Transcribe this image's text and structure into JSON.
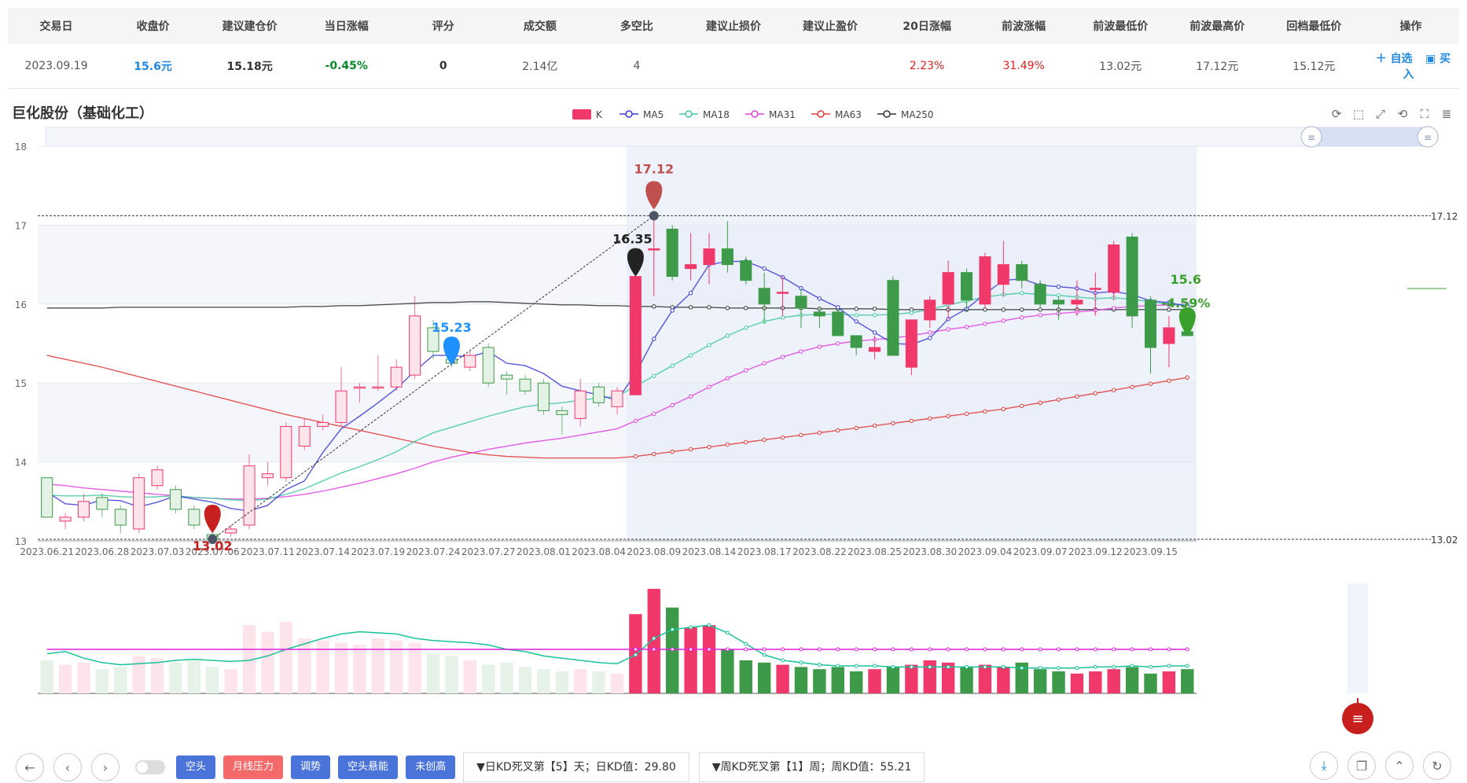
{
  "table": {
    "headers": [
      "交易日",
      "收盘价",
      "建议建仓价",
      "当日涨幅",
      "评分",
      "成交额",
      "多空比",
      "建议止损价",
      "建议止盈价",
      "20日涨幅",
      "前波涨幅",
      "前波最低价",
      "前波最高价",
      "回档最低价",
      "操作"
    ],
    "row": {
      "date": "2023.09.19",
      "close": "15.6元",
      "entry": "15.18元",
      "change": "-0.45%",
      "score": "0",
      "turnover": "2.14亿",
      "ratio": "4",
      "stop_loss": "",
      "take_profit": "",
      "change20": "2.23%",
      "prev_wave_change": "31.49%",
      "prev_low": "13.02元",
      "prev_high": "17.12元",
      "pullback_low": "15.12元",
      "action_watch": "＋ 自选",
      "action_buy": "▣ 买入"
    }
  },
  "chart_title": "巨化股份（基础化工）",
  "colors": {
    "up": "#f0386b",
    "down": "#3d9a48",
    "ma5": "#3b3bd9",
    "ma18": "#3cc9a0",
    "ma31": "#e040e0",
    "ma63": "#e03838",
    "ma250": "#333333"
  },
  "chart_data": {
    "type": "candlestick",
    "title": "巨化股份（基础化工）",
    "legend": [
      {
        "key": "k",
        "name": "K"
      },
      {
        "key": "ma5",
        "name": "MA5"
      },
      {
        "key": "ma18",
        "name": "MA18"
      },
      {
        "key": "ma31",
        "name": "MA31"
      },
      {
        "key": "ma63",
        "name": "MA63"
      },
      {
        "key": "ma250",
        "name": "MA250"
      }
    ],
    "legend_position": "top-center",
    "ylim": [
      13,
      18
    ],
    "yticks": [
      "13",
      "14",
      "15",
      "16",
      "17",
      "18"
    ],
    "x_tick_labels": [
      "2023.06.21",
      "2023.06.28",
      "2023.07.03",
      "2023.07.06",
      "2023.07.11",
      "2023.07.14",
      "2023.07.19",
      "2023.07.24",
      "2023.07.27",
      "2023.08.01",
      "2023.08.04",
      "2023.08.09",
      "2023.08.14",
      "2023.08.17",
      "2023.08.22",
      "2023.08.25",
      "2023.08.30",
      "2023.09.04",
      "2023.09.07",
      "2023.09.12",
      "2023.09.15"
    ],
    "candles": [
      [
        13.8,
        13.3,
        13.8,
        13.3
      ],
      [
        13.25,
        13.3,
        13.35,
        13.15
      ],
      [
        13.3,
        13.5,
        13.6,
        13.25
      ],
      [
        13.55,
        13.4,
        13.6,
        13.3
      ],
      [
        13.4,
        13.2,
        13.45,
        13.1
      ],
      [
        13.15,
        13.8,
        13.85,
        13.1
      ],
      [
        13.7,
        13.9,
        13.95,
        13.65
      ],
      [
        13.65,
        13.4,
        13.7,
        13.35
      ],
      [
        13.4,
        13.2,
        13.45,
        13.15
      ],
      [
        13.08,
        13.02,
        13.15,
        13.02
      ],
      [
        13.1,
        13.15,
        13.2,
        13.05
      ],
      [
        13.2,
        13.95,
        14.1,
        13.15
      ],
      [
        13.8,
        13.85,
        14.0,
        13.7
      ],
      [
        13.8,
        14.45,
        14.5,
        13.75
      ],
      [
        14.2,
        14.45,
        14.55,
        14.15
      ],
      [
        14.45,
        14.5,
        14.6,
        14.4
      ],
      [
        14.5,
        14.9,
        15.2,
        14.45
      ],
      [
        14.95,
        14.95,
        15.0,
        14.75
      ],
      [
        14.95,
        14.95,
        15.35,
        14.9
      ],
      [
        14.95,
        15.2,
        15.3,
        14.9
      ],
      [
        15.1,
        15.85,
        16.1,
        15.05
      ],
      [
        15.7,
        15.4,
        15.8,
        15.3
      ],
      [
        15.3,
        15.25,
        15.4,
        15.2
      ],
      [
        15.2,
        15.35,
        15.4,
        15.15
      ],
      [
        15.45,
        15.0,
        15.5,
        14.95
      ],
      [
        15.1,
        15.05,
        15.15,
        14.85
      ],
      [
        15.05,
        14.9,
        15.1,
        14.85
      ],
      [
        15.0,
        14.65,
        15.05,
        14.6
      ],
      [
        14.65,
        14.6,
        14.7,
        14.35
      ],
      [
        14.55,
        14.9,
        15.05,
        14.45
      ],
      [
        14.95,
        14.75,
        15.0,
        14.7
      ],
      [
        14.7,
        14.9,
        14.95,
        14.6
      ],
      [
        14.85,
        16.35,
        16.35,
        14.85
      ],
      [
        16.7,
        16.7,
        17.12,
        16.1
      ],
      [
        16.95,
        16.35,
        17.0,
        16.3
      ],
      [
        16.45,
        16.5,
        16.9,
        16.3
      ],
      [
        16.5,
        16.7,
        16.9,
        16.25
      ],
      [
        16.7,
        16.5,
        17.05,
        16.4
      ],
      [
        16.55,
        16.3,
        16.6,
        16.25
      ],
      [
        16.2,
        16.0,
        16.4,
        15.75
      ],
      [
        16.15,
        16.15,
        16.35,
        15.85
      ],
      [
        16.1,
        15.95,
        16.2,
        15.7
      ],
      [
        15.9,
        15.85,
        15.95,
        15.7
      ],
      [
        15.9,
        15.6,
        15.95,
        15.6
      ],
      [
        15.6,
        15.45,
        15.6,
        15.35
      ],
      [
        15.4,
        15.45,
        15.6,
        15.3
      ],
      [
        16.3,
        15.35,
        16.35,
        15.35
      ],
      [
        15.2,
        15.8,
        15.8,
        15.1
      ],
      [
        15.8,
        16.05,
        16.1,
        15.7
      ],
      [
        16.0,
        16.4,
        16.55,
        15.8
      ],
      [
        16.4,
        16.05,
        16.45,
        15.9
      ],
      [
        16.0,
        16.6,
        16.65,
        15.95
      ],
      [
        16.25,
        16.5,
        16.8,
        16.1
      ],
      [
        16.5,
        16.3,
        16.55,
        16.2
      ],
      [
        16.25,
        16.0,
        16.3,
        15.95
      ],
      [
        16.05,
        16.0,
        16.1,
        15.8
      ],
      [
        16.0,
        16.05,
        16.3,
        15.85
      ],
      [
        16.2,
        16.2,
        16.4,
        15.85
      ],
      [
        16.15,
        16.75,
        16.8,
        16.05
      ],
      [
        16.85,
        15.85,
        16.9,
        15.7
      ],
      [
        16.05,
        15.45,
        16.1,
        15.12
      ],
      [
        15.5,
        15.7,
        15.85,
        15.2
      ],
      [
        15.65,
        15.6,
        15.75,
        15.6
      ]
    ],
    "ma5": [
      13.62,
      13.47,
      13.45,
      13.52,
      13.51,
      13.43,
      13.49,
      13.57,
      13.53,
      13.49,
      13.41,
      13.38,
      13.45,
      13.65,
      13.76,
      14.12,
      14.42,
      14.58,
      14.75,
      14.93,
      15.15,
      15.35,
      15.35,
      15.33,
      15.4,
      15.25,
      15.22,
      15.12,
      14.96,
      14.9,
      14.85,
      14.78,
      15.12,
      15.56,
      15.92,
      16.14,
      16.5,
      16.54,
      16.54,
      16.45,
      16.34,
      16.2,
      16.07,
      15.96,
      15.78,
      15.64,
      15.5,
      15.49,
      15.57,
      15.81,
      15.94,
      16.13,
      16.3,
      16.32,
      16.24,
      16.22,
      16.2,
      16.14,
      16.16,
      16.12,
      16.04,
      16.02,
      15.97
    ],
    "ma18": [
      13.58,
      13.57,
      13.57,
      13.58,
      13.56,
      13.55,
      13.56,
      13.57,
      13.55,
      13.54,
      13.52,
      13.51,
      13.53,
      13.59,
      13.66,
      13.76,
      13.86,
      13.94,
      14.03,
      14.13,
      14.26,
      14.37,
      14.44,
      14.51,
      14.58,
      14.64,
      14.7,
      14.73,
      14.75,
      14.78,
      14.81,
      14.83,
      14.96,
      15.09,
      15.22,
      15.35,
      15.48,
      15.6,
      15.7,
      15.78,
      15.83,
      15.86,
      15.87,
      15.87,
      15.86,
      15.86,
      15.87,
      15.89,
      15.93,
      15.99,
      16.04,
      16.09,
      16.12,
      16.14,
      16.12,
      16.11,
      16.09,
      16.07,
      16.08,
      16.06,
      16.03,
      16.0,
      15.99
    ],
    "ma31": [
      13.72,
      13.7,
      13.67,
      13.65,
      13.63,
      13.61,
      13.59,
      13.57,
      13.55,
      13.54,
      13.53,
      13.53,
      13.54,
      13.56,
      13.59,
      13.63,
      13.68,
      13.73,
      13.79,
      13.85,
      13.92,
      14.0,
      14.06,
      14.11,
      14.16,
      14.2,
      14.24,
      14.27,
      14.3,
      14.34,
      14.38,
      14.42,
      14.52,
      14.61,
      14.72,
      14.83,
      14.95,
      15.06,
      15.16,
      15.25,
      15.33,
      15.4,
      15.46,
      15.5,
      15.53,
      15.55,
      15.57,
      15.6,
      15.64,
      15.68,
      15.71,
      15.75,
      15.79,
      15.83,
      15.86,
      15.88,
      15.9,
      15.92,
      15.95,
      15.97,
      15.98,
      15.99,
      16.0
    ],
    "ma63": [
      15.35,
      15.3,
      15.25,
      15.2,
      15.14,
      15.08,
      15.02,
      14.96,
      14.9,
      14.84,
      14.78,
      14.72,
      14.66,
      14.6,
      14.55,
      14.5,
      14.45,
      14.4,
      14.35,
      14.3,
      14.25,
      14.2,
      14.16,
      14.12,
      14.09,
      14.07,
      14.06,
      14.05,
      14.05,
      14.05,
      14.05,
      14.05,
      14.07,
      14.1,
      14.13,
      14.16,
      14.19,
      14.22,
      14.25,
      14.28,
      14.31,
      14.34,
      14.37,
      14.4,
      14.43,
      14.46,
      14.49,
      14.52,
      14.55,
      14.58,
      14.61,
      14.64,
      14.67,
      14.71,
      14.75,
      14.79,
      14.83,
      14.87,
      14.91,
      14.95,
      14.99,
      15.03,
      15.07
    ],
    "ma250": [
      15.95,
      15.95,
      15.95,
      15.95,
      15.96,
      15.96,
      15.96,
      15.96,
      15.96,
      15.96,
      15.96,
      15.96,
      15.96,
      15.96,
      15.97,
      15.97,
      15.98,
      15.98,
      15.99,
      16.0,
      16.01,
      16.02,
      16.02,
      16.03,
      16.03,
      16.02,
      16.01,
      16.0,
      15.99,
      15.99,
      15.98,
      15.98,
      15.97,
      15.97,
      15.96,
      15.96,
      15.96,
      15.95,
      15.95,
      15.95,
      15.95,
      15.95,
      15.94,
      15.94,
      15.94,
      15.94,
      15.93,
      15.93,
      15.93,
      15.93,
      15.93,
      15.93,
      15.93,
      15.93,
      15.93,
      15.93,
      15.93,
      15.93,
      15.93,
      15.93,
      15.93,
      15.93,
      15.93
    ],
    "volumes": [
      30,
      26,
      28,
      22,
      24,
      34,
      32,
      28,
      30,
      24,
      22,
      62,
      56,
      65,
      50,
      48,
      46,
      44,
      50,
      48,
      46,
      36,
      34,
      30,
      26,
      28,
      24,
      22,
      20,
      22,
      20,
      18,
      72,
      95,
      78,
      60,
      62,
      40,
      30,
      28,
      26,
      24,
      22,
      24,
      20,
      22,
      24,
      26,
      30,
      28,
      24,
      26,
      24,
      28,
      22,
      20,
      18,
      20,
      22,
      24,
      18,
      20,
      22
    ],
    "vol_line_a": [
      36,
      38,
      32,
      28,
      26,
      27,
      28,
      30,
      31,
      30,
      29,
      30,
      34,
      40,
      45,
      50,
      54,
      56,
      55,
      54,
      50,
      48,
      47,
      46,
      44,
      40,
      38,
      34,
      32,
      30,
      28,
      27,
      35,
      50,
      58,
      60,
      62,
      55,
      45,
      35,
      30,
      28,
      26,
      25,
      25,
      25,
      24,
      24,
      24,
      24,
      24,
      24,
      24,
      23,
      23,
      23,
      23,
      24,
      24,
      25,
      24,
      25,
      25
    ],
    "vol_line_b": [
      40,
      40,
      40,
      40,
      40,
      40,
      40,
      40,
      40,
      40,
      40,
      40,
      40,
      40,
      40,
      40,
      40,
      40,
      40,
      40,
      40,
      40,
      40,
      40,
      40,
      40,
      40,
      40,
      40,
      40,
      40,
      40,
      40,
      40,
      40,
      40,
      40,
      40,
      40,
      40,
      40,
      40,
      40,
      40,
      40,
      40,
      40,
      40,
      40,
      40,
      40,
      40,
      40,
      40,
      40,
      40,
      40,
      40,
      40,
      40,
      40,
      40,
      40
    ],
    "markers": {
      "low": {
        "value": "13.02",
        "label": "13.02"
      },
      "high": {
        "value": "17.12",
        "label": "17.12"
      },
      "mid_a": {
        "value": "15.23",
        "label": "15.23"
      },
      "mid_b": {
        "value": "16.35",
        "label": "16.35"
      },
      "last": {
        "value": "15.6",
        "label": "15.6",
        "change": "-4.59%"
      }
    },
    "ref_lines": {
      "high": "17.12",
      "low": "13.02"
    }
  },
  "bottom": {
    "tags": [
      "空头",
      "月线压力",
      "调势",
      "空头悬能",
      "未创高"
    ],
    "info_daily": "▼日KD死叉第【5】天；日KD值：29.80",
    "info_weekly": "▼周KD死叉第【1】周；周KD值：55.21"
  },
  "icons": {
    "back": "back-arrow-icon",
    "prev": "chevron-left-icon",
    "next": "chevron-right-icon",
    "download": "download-icon",
    "copy": "copy-icon",
    "top": "chevron-up-icon",
    "refresh": "refresh-icon",
    "menu": "menu-icon"
  }
}
